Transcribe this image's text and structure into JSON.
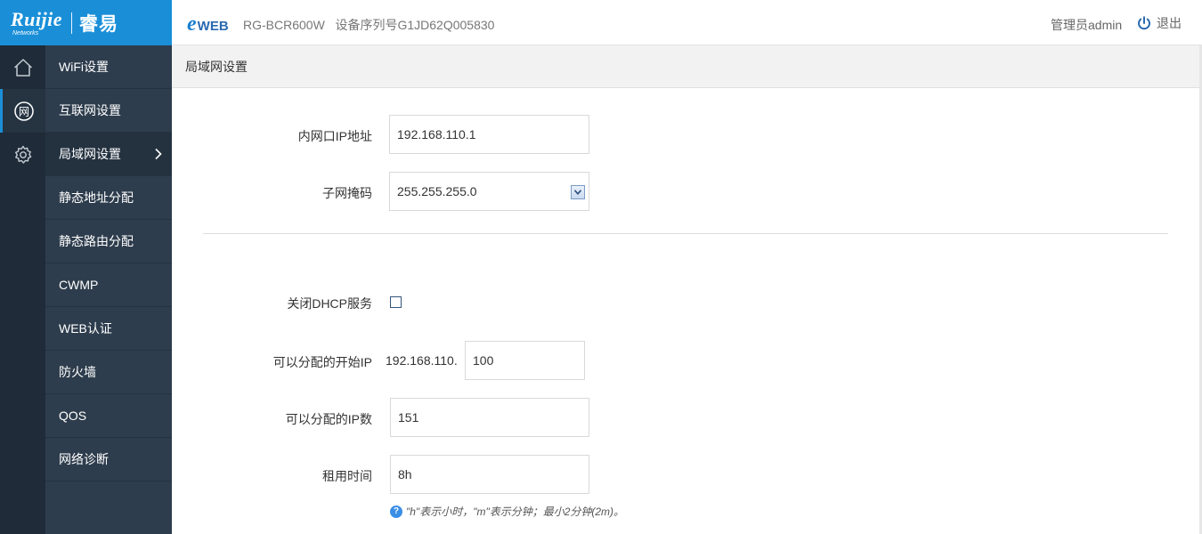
{
  "header": {
    "brand_en": "Ruijie",
    "brand_sub": "Networks",
    "brand_cn": "睿易",
    "eweb_e": "e",
    "eweb_text": "WEB",
    "model": "RG-BCR600W",
    "serial_text": "设备序列号G1JD62Q005830",
    "admin": "管理员admin",
    "logout": "退出"
  },
  "rail": {
    "icons": [
      "home-icon",
      "network-icon",
      "gear-icon"
    ],
    "network_glyph": "网"
  },
  "menu": {
    "items": [
      {
        "label": "WiFi设置"
      },
      {
        "label": "互联网设置"
      },
      {
        "label": "局域网设置",
        "active": true
      },
      {
        "label": "静态地址分配"
      },
      {
        "label": "静态路由分配"
      },
      {
        "label": "CWMP"
      },
      {
        "label": "WEB认证"
      },
      {
        "label": "防火墙"
      },
      {
        "label": "QOS"
      },
      {
        "label": "网络诊断"
      }
    ]
  },
  "breadcrumb": "局域网设置",
  "form": {
    "lan_ip": {
      "label": "内网口IP地址",
      "value": "192.168.110.1"
    },
    "subnet_mask": {
      "label": "子网掩码",
      "value": "255.255.255.0"
    },
    "dhcp_disable": {
      "label": "关闭DHCP服务",
      "checked": false
    },
    "start_ip": {
      "label": "可以分配的开始IP",
      "prefix": "192.168.110.",
      "value": "100"
    },
    "ip_count": {
      "label": "可以分配的IP数",
      "value": "151"
    },
    "lease_time": {
      "label": "租用时间",
      "value": "8h"
    },
    "hint": "\"h\"表示小时，\"m\"表示分钟；最小2分钟(2m)。"
  },
  "colors": {
    "accent": "#1a8fd8",
    "rail_bg": "#1f2b38",
    "menu_bg": "#2e3d4d"
  }
}
